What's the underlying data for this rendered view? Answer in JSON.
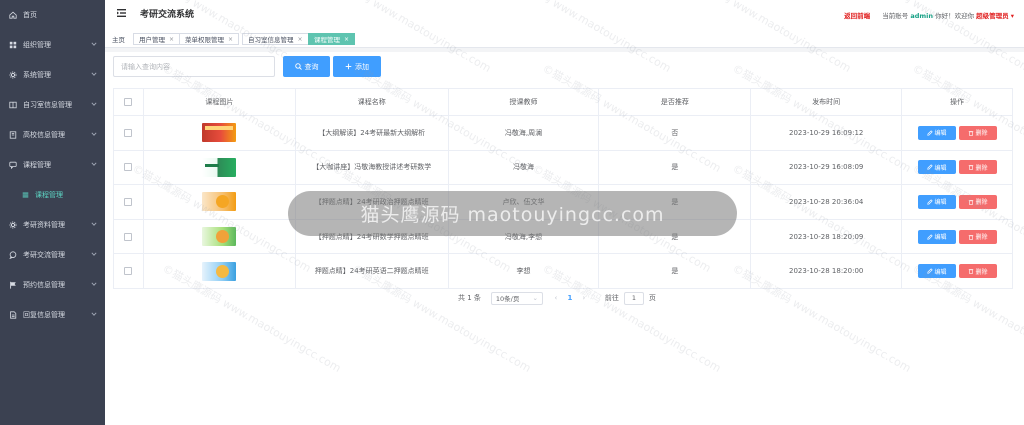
{
  "sidebar": {
    "items": [
      {
        "label": "首页",
        "icon": "home-icon"
      },
      {
        "label": "组织管理",
        "icon": "grid-icon"
      },
      {
        "label": "系统管理",
        "icon": "gear-icon"
      },
      {
        "label": "自习室信息管理",
        "icon": "book-icon"
      },
      {
        "label": "高校信息管理",
        "icon": "building-icon"
      },
      {
        "label": "课程管理",
        "icon": "chat-icon"
      },
      {
        "label": "课程管理",
        "icon": "list-icon"
      },
      {
        "label": "考研资料管理",
        "icon": "gear-icon"
      },
      {
        "label": "考研交流管理",
        "icon": "comment-icon"
      },
      {
        "label": "预约信息管理",
        "icon": "flag-icon"
      },
      {
        "label": "回复信息管理",
        "icon": "doc-icon"
      }
    ]
  },
  "header": {
    "title": "考研交流系统",
    "back_home": "返回前端",
    "account_prefix": "当前账号",
    "account_name": "admin",
    "greeting": "你好！欢迎你",
    "role": "超级管理员",
    "caret": "▾"
  },
  "tabs": [
    {
      "label": "主页",
      "closable": false
    },
    {
      "label": "用户管理",
      "closable": true
    },
    {
      "label": "菜单权限管理",
      "closable": true
    },
    {
      "label": "自习室信息管理",
      "closable": true
    },
    {
      "label": "课程管理",
      "closable": true,
      "active": true
    }
  ],
  "search": {
    "placeholder": "请输入查询内容",
    "query_label": "查询",
    "add_label": "添加"
  },
  "table": {
    "headers": [
      "课程图片",
      "课程名称",
      "授课教师",
      "是否推荐",
      "发布时间",
      "操作"
    ],
    "edit_label": "编辑",
    "delete_label": "删除",
    "rows": [
      {
        "image": "t-red",
        "name": "【大纲解读】24考研最新大纲解析",
        "teacher": "冯敬海,周澜",
        "recommended": "否",
        "published": "2023-10-29 16:09:12"
      },
      {
        "image": "t-green",
        "name": "【大咖讲座】冯敬海教授讲述考研数学",
        "teacher": "冯敬海",
        "recommended": "是",
        "published": "2023-10-29 16:08:09"
      },
      {
        "image": "t-orange",
        "name": "【押题点睛】24考研政治押题点睛班",
        "teacher": "卢欣、伍文华",
        "recommended": "是",
        "published": "2023-10-28 20:36:04"
      },
      {
        "image": "t-ogreen",
        "name": "【押题点睛】24考研数学押题点睛班",
        "teacher": "冯敬海,李想",
        "recommended": "是",
        "published": "2023-10-28 18:20:09"
      },
      {
        "image": "t-blue",
        "name": "押题点睛】24考研英语二押题点睛班",
        "teacher": "李想",
        "recommended": "是",
        "published": "2023-10-28 18:20:00"
      }
    ]
  },
  "pagination": {
    "total": "共 1 条",
    "page_size": "10条/页",
    "prev": "‹",
    "current": "1",
    "next": "›",
    "jump_prefix": "前往",
    "jump_value": "1",
    "jump_suffix": "页"
  },
  "watermark": {
    "banner": "猫头鹰源码 maotouyingcc.com",
    "tile": "©猫头鹰源码 www.maotouyingcc.com"
  }
}
